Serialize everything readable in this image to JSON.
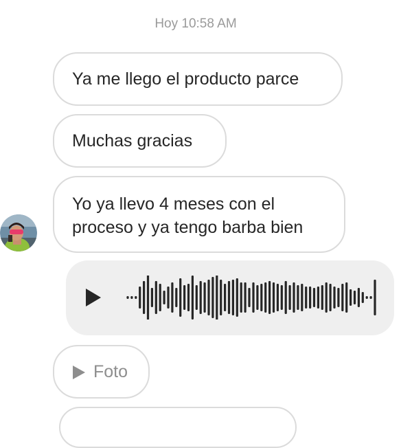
{
  "conversation": {
    "timestamp": "Hoy 10:58 AM",
    "messages": [
      {
        "type": "text",
        "lines": [
          "Ya me llego el producto parce"
        ]
      },
      {
        "type": "text",
        "lines": [
          "Muchas gracias"
        ]
      },
      {
        "type": "text",
        "lines": [
          "Yo ya llevo 4 meses con el",
          "proceso y ya tengo barba bien"
        ]
      },
      {
        "type": "voice",
        "play_icon": "play-icon"
      },
      {
        "type": "photo",
        "label": "Foto",
        "icon": "play-triangle-icon"
      }
    ]
  },
  "colors": {
    "bubble_border": "#dbdbdb",
    "voice_bg": "#efefef",
    "text": "#262626",
    "muted": "#8e8e8e",
    "waveform": "#262626"
  }
}
